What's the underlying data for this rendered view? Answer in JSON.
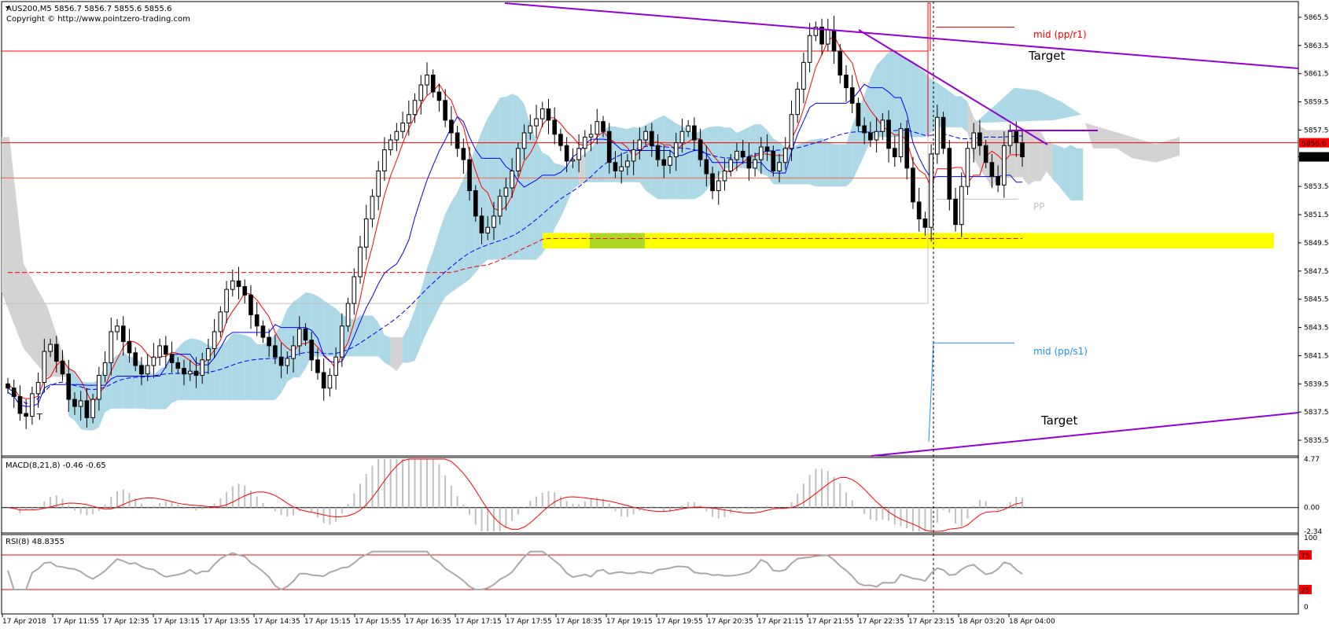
{
  "window": {
    "symbol_line": "AUS200,M5  5856.7 5856.7 5855.6 5855.6",
    "copyright": "Copyright © http://www.pointzero-trading.com"
  },
  "colors": {
    "bull": "#000000",
    "bear": "#000000",
    "tenkan": "#ff0000",
    "kijun": "#0000ff",
    "kumo_bull": "#add8e6",
    "kumo_bear": "#d3d3d3",
    "pivot_r1": "#ff0000",
    "pivot_s1": "#1e90ff",
    "pp": "#c0c0c0",
    "trend": "#9400d3",
    "zone": "#ffff00",
    "macd_hist": "#c0c0c0",
    "macd_signal": "#ff0000",
    "rsi_line": "#a9a9a9",
    "rsi_level": "#ff0000"
  },
  "chart_data": [
    {
      "type": "candlestick",
      "title": "AUS200,M5",
      "ylim": [
        5834.5,
        5866.5
      ],
      "y_ticks": [
        "5865.5",
        "5863.5",
        "5861.5",
        "5859.5",
        "5857.5",
        "5855.6",
        "5853.5",
        "5851.5",
        "5849.5",
        "5847.5",
        "5845.5",
        "5843.5",
        "5841.5",
        "5839.5",
        "5837.5",
        "5835.5"
      ],
      "current_price": "5856.6",
      "last_price_label": "5855.6",
      "x_labels": [
        "17 Apr 2018",
        "17 Apr 11:55",
        "17 Apr 12:35",
        "17 Apr 13:15",
        "17 Apr 13:55",
        "17 Apr 14:35",
        "17 Apr 15:15",
        "17 Apr 15:55",
        "17 Apr 16:35",
        "17 Apr 17:15",
        "17 Apr 17:55",
        "17 Apr 18:35",
        "17 Apr 19:15",
        "17 Apr 19:55",
        "17 Apr 20:35",
        "17 Apr 21:15",
        "17 Apr 21:55",
        "17 Apr 22:35",
        "17 Apr 23:15",
        "18 Apr 03:20",
        "18 Apr 04:00"
      ],
      "close_path": [
        5839.2,
        5838.6,
        5837.4,
        5837.2,
        5838.8,
        5839.6,
        5841.8,
        5842.3,
        5841.1,
        5840.2,
        5838.4,
        5837.9,
        5838.3,
        5837.1,
        5838.4,
        5840.1,
        5841.0,
        5843.2,
        5843.6,
        5842.5,
        5841.7,
        5840.8,
        5840.2,
        5840.8,
        5841.4,
        5842.2,
        5841.6,
        5841.0,
        5840.6,
        5840.2,
        5840.4,
        5840.1,
        5841.2,
        5842.0,
        5843.2,
        5844.6,
        5846.2,
        5846.8,
        5846.4,
        5845.8,
        5844.4,
        5843.6,
        5842.8,
        5842.2,
        5841.4,
        5840.8,
        5841.3,
        5842.2,
        5843.4,
        5842.6,
        5841.2,
        5840.3,
        5839.2,
        5840.1,
        5841.4,
        5843.6,
        5845.2,
        5847.1,
        5849.2,
        5851.2,
        5852.8,
        5854.6,
        5856.1,
        5856.8,
        5857.4,
        5858.0,
        5858.6,
        5859.6,
        5860.7,
        5861.4,
        5860.2,
        5859.6,
        5858.2,
        5857.3,
        5856.2,
        5855.4,
        5853.2,
        5851.4,
        5850.2,
        5850.6,
        5851.4,
        5852.8,
        5853.4,
        5854.6,
        5856.2,
        5857.3,
        5857.8,
        5858.3,
        5859.0,
        5858.2,
        5857.2,
        5856.4,
        5855.3,
        5855.4,
        5856.2,
        5857.0,
        5857.2,
        5858.1,
        5857.4,
        5855.2,
        5854.6,
        5854.9,
        5855.3,
        5856.1,
        5856.8,
        5857.4,
        5856.4,
        5855.4,
        5855.0,
        5855.6,
        5856.6,
        5857.4,
        5857.8,
        5856.8,
        5855.4,
        5854.4,
        5853.2,
        5853.9,
        5854.6,
        5855.4,
        5856.0,
        5855.6,
        5854.8,
        5855.4,
        5856.3,
        5856.0,
        5854.6,
        5855.2,
        5856.2,
        5858.6,
        5860.4,
        5862.3,
        5864.2,
        5864.8,
        5863.6,
        5864.6,
        5863.1,
        5861.4,
        5860.5,
        5859.4,
        5857.8,
        5857.3,
        5856.8,
        5857.4,
        5858.2,
        5856.2,
        5855.6,
        5857.6,
        5854.8,
        5852.4,
        5851.2,
        5850.6,
        5855.8,
        5858.4,
        5856.2,
        5852.6,
        5850.8,
        5853.5,
        5856.2,
        5857.3,
        5856.4,
        5855.2,
        5854.2,
        5853.6,
        5856.4,
        5857.4,
        5856.6,
        5855.6
      ]
    },
    {
      "type": "bar",
      "title": "MACD(8,21,8) -0.46 -0.65",
      "ylim": [
        -2.34,
        4.77
      ],
      "y_ticks": [
        "4.77",
        "0.00",
        "-2.34"
      ]
    },
    {
      "type": "line",
      "title": "RSI(8) 48.8355",
      "ylim": [
        0,
        100
      ],
      "y_ticks": [
        "100",
        "75",
        "25",
        "0"
      ],
      "levels": [
        75,
        25
      ]
    }
  ],
  "annotations": {
    "mid_r1": "mid (pp/r1)",
    "mid_s1": "mid (pp/s1)",
    "pp": "PP",
    "target_upper": "Target",
    "target_lower": "Target",
    "t_marker": "T"
  }
}
